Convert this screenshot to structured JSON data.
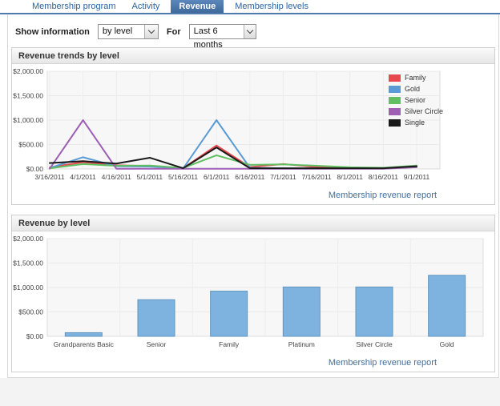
{
  "tabs": {
    "items": [
      {
        "label": "Membership program",
        "active": false
      },
      {
        "label": "Activity",
        "active": false
      },
      {
        "label": "Revenue",
        "active": true
      },
      {
        "label": "Membership levels",
        "active": false
      }
    ]
  },
  "filters": {
    "show_information_label": "Show information",
    "show_information_value": "by level",
    "for_label": "For",
    "period_value": "Last 6 months"
  },
  "panels": {
    "trends": {
      "title": "Revenue trends by level",
      "link_label": "Membership revenue report"
    },
    "by_level": {
      "title": "Revenue by level",
      "link_label": "Membership revenue report"
    }
  },
  "colors": {
    "accent_blue": "#4e79ad",
    "link_blue": "#43709f",
    "bar_fill": "#7db3de",
    "bar_border": "#6296c0"
  },
  "chart_data": [
    {
      "type": "line",
      "title": "Revenue trends by level",
      "x": [
        "3/16/2011",
        "4/1/2011",
        "4/16/2011",
        "5/1/2011",
        "5/16/2011",
        "6/1/2011",
        "6/16/2011",
        "7/1/2011",
        "7/16/2011",
        "8/1/2011",
        "8/16/2011",
        "9/1/2011"
      ],
      "ylim": [
        0,
        2000
      ],
      "ytick_values": [
        0,
        500,
        1000,
        1500,
        2000
      ],
      "ytick_labels": [
        "$0.00",
        "$500.00",
        "$1,000.00",
        "$1,500.00",
        "$2,000.00"
      ],
      "grid": true,
      "legend_position": "top-right",
      "series": [
        {
          "name": "Family",
          "color": "#e8484f",
          "values": [
            30,
            140,
            75,
            60,
            15,
            480,
            40,
            100,
            40,
            15,
            15,
            60
          ]
        },
        {
          "name": "Gold",
          "color": "#5b9bd5",
          "values": [
            20,
            240,
            55,
            50,
            10,
            1000,
            25,
            15,
            10,
            10,
            10,
            50
          ]
        },
        {
          "name": "Senior",
          "color": "#5fbf61",
          "values": [
            15,
            100,
            65,
            70,
            20,
            280,
            85,
            95,
            65,
            35,
            25,
            70
          ]
        },
        {
          "name": "Silver Circle",
          "color": "#9e5fb5",
          "values": [
            5,
            1000,
            5,
            5,
            5,
            5,
            5,
            5,
            5,
            5,
            5,
            35
          ]
        },
        {
          "name": "Single",
          "color": "#1a1a1a",
          "values": [
            120,
            160,
            110,
            230,
            15,
            440,
            15,
            15,
            15,
            15,
            15,
            55
          ]
        }
      ]
    },
    {
      "type": "bar",
      "title": "Revenue by level",
      "categories": [
        "Grandparents Basic",
        "Senior",
        "Family",
        "Platinum",
        "Silver Circle",
        "Gold"
      ],
      "values": [
        75,
        750,
        925,
        1010,
        1010,
        1250
      ],
      "ylim": [
        0,
        2000
      ],
      "ytick_values": [
        0,
        500,
        1000,
        1500,
        2000
      ],
      "ytick_labels": [
        "$0.00",
        "$500.00",
        "$1,000.00",
        "$1,500.00",
        "$2,000.00"
      ],
      "grid": true
    }
  ]
}
